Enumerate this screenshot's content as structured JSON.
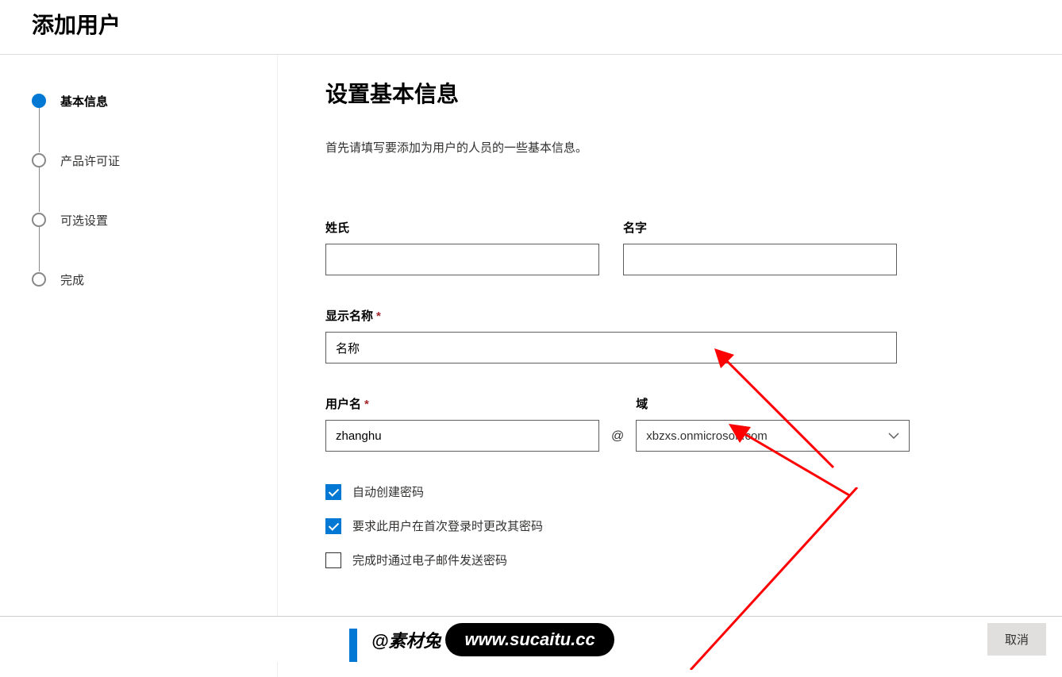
{
  "header": {
    "title": "添加用户"
  },
  "steps": [
    {
      "label": "基本信息",
      "active": true
    },
    {
      "label": "产品许可证",
      "active": false
    },
    {
      "label": "可选设置",
      "active": false
    },
    {
      "label": "完成",
      "active": false
    }
  ],
  "main": {
    "heading": "设置基本信息",
    "subtitle": "首先请填写要添加为用户的人员的一些基本信息。",
    "fields": {
      "lastname_label": "姓氏",
      "lastname_value": "",
      "firstname_label": "名字",
      "firstname_value": "",
      "displayname_label": "显示名称",
      "displayname_value": "名称",
      "username_label": "用户名",
      "username_value": "zhanghu",
      "domain_label": "域",
      "domain_value": "xbzxs.onmicrosoft.com",
      "at_symbol": "@"
    },
    "checkboxes": {
      "auto_password": {
        "label": "自动创建密码",
        "checked": true
      },
      "change_on_login": {
        "label": "要求此用户在首次登录时更改其密码",
        "checked": true
      },
      "email_password": {
        "label": "完成时通过电子邮件发送密码",
        "checked": false
      }
    }
  },
  "footer": {
    "cancel": "取消"
  },
  "watermark": {
    "left": "@素材兔",
    "right": "www.sucaitu.cc"
  }
}
